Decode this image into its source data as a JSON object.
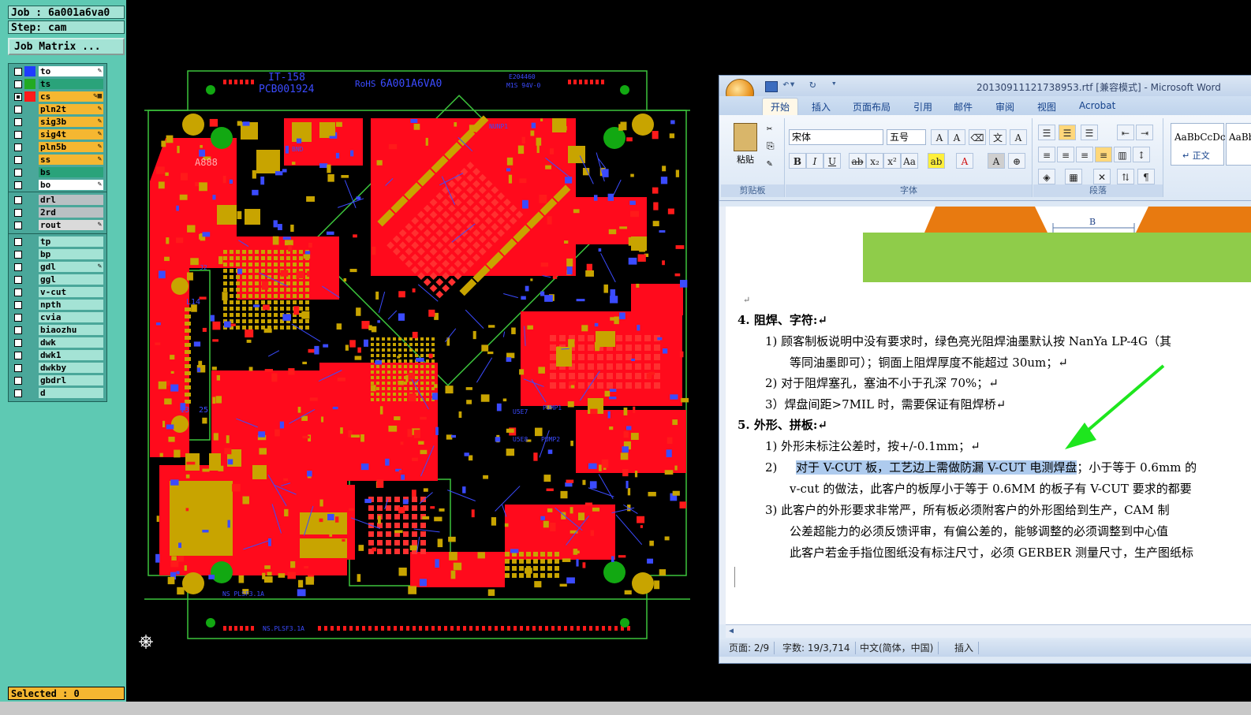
{
  "left_panel": {
    "job_label": "Job : 6a001a6va0",
    "step_label": "Step: cam",
    "job_matrix_button": "Job Matrix ...",
    "layer_groups": [
      [
        {
          "name": "to",
          "swatch": "#1f3cff",
          "bg": "#ffffff",
          "mark": "✎"
        },
        {
          "name": "ts",
          "swatch": "#22aa22",
          "bg": "#2aa37a",
          "mark": ""
        },
        {
          "name": "cs",
          "swatch": "#ff1a1a",
          "bg": "#f5b731",
          "mark": "✎▦"
        },
        {
          "name": "pln2t",
          "swatch": "",
          "bg": "#f5b731",
          "mark": "✎"
        },
        {
          "name": "sig3b",
          "swatch": "",
          "bg": "#f5b731",
          "mark": "✎"
        },
        {
          "name": "sig4t",
          "swatch": "",
          "bg": "#f5b731",
          "mark": "✎"
        },
        {
          "name": "pln5b",
          "swatch": "",
          "bg": "#f5b731",
          "mark": "✎"
        },
        {
          "name": "ss",
          "swatch": "",
          "bg": "#f5b731",
          "mark": "✎"
        },
        {
          "name": "bs",
          "swatch": "",
          "bg": "#2aa37a",
          "mark": ""
        },
        {
          "name": "bo",
          "swatch": "",
          "bg": "#ffffff",
          "mark": "✎"
        }
      ],
      [
        {
          "name": "drl",
          "swatch": "",
          "bg": "#b9c0c3",
          "mark": ""
        },
        {
          "name": "2rd",
          "swatch": "",
          "bg": "#b9c0c3",
          "mark": ""
        },
        {
          "name": "rout",
          "swatch": "",
          "bg": "#dadada",
          "mark": "✎"
        }
      ],
      [
        {
          "name": "tp",
          "swatch": "",
          "bg": "#a4e3d5",
          "mark": ""
        },
        {
          "name": "bp",
          "swatch": "",
          "bg": "#a4e3d5",
          "mark": ""
        },
        {
          "name": "gdl",
          "swatch": "",
          "bg": "#a4e3d5",
          "mark": "✎"
        },
        {
          "name": "ggl",
          "swatch": "",
          "bg": "#a4e3d5",
          "mark": ""
        },
        {
          "name": "v-cut",
          "swatch": "",
          "bg": "#a4e3d5",
          "mark": ""
        },
        {
          "name": "npth",
          "swatch": "",
          "bg": "#a4e3d5",
          "mark": ""
        },
        {
          "name": "cvia",
          "swatch": "",
          "bg": "#a4e3d5",
          "mark": ""
        },
        {
          "name": "biaozhu",
          "swatch": "",
          "bg": "#a4e3d5",
          "mark": ""
        },
        {
          "name": "dwk",
          "swatch": "",
          "bg": "#a4e3d5",
          "mark": ""
        },
        {
          "name": "dwk1",
          "swatch": "",
          "bg": "#a4e3d5",
          "mark": ""
        },
        {
          "name": "dwkby",
          "swatch": "",
          "bg": "#a4e3d5",
          "mark": ""
        },
        {
          "name": "gbdrl",
          "swatch": "",
          "bg": "#a4e3d5",
          "mark": ""
        },
        {
          "name": "d",
          "swatch": "",
          "bg": "#a4e3d5",
          "mark": ""
        }
      ]
    ],
    "selected_label": "Selected : 0"
  },
  "pcb": {
    "silk_texts": [
      "IT-158",
      "PCB001924",
      "RoHS",
      "6A001A6VA0",
      "E204460",
      "M1S 94V-0",
      "A888",
      "L14",
      "13",
      "25",
      "NS PLSF3.1A",
      "NS.PLSF3.1A",
      "BND",
      "NUNP1",
      "PUMP1",
      "PUMP2",
      "J2",
      "U5E7",
      "U5E8"
    ]
  },
  "word": {
    "title": "20130911121738953.rtf [兼容模式] - Microsoft Word",
    "tabs": [
      "开始",
      "插入",
      "页面布局",
      "引用",
      "邮件",
      "审阅",
      "视图",
      "Acrobat"
    ],
    "clipboard": {
      "paste": "粘贴",
      "group": "剪贴板"
    },
    "font": {
      "name": "宋体",
      "size": "五号",
      "group": "字体"
    },
    "paragraph_group": "段落",
    "styles": {
      "sample": "AaBbCcDc",
      "sample2": "AaBbC",
      "normal": "↵ 正文"
    },
    "figure_label": "B",
    "lines": [
      "4.   阻焊、字符:↵",
      "1)   顾客制板说明中没有要求时，绿色亮光阻焊油墨默认按 NanYa  LP-4G（其",
      "等同油墨即可）；铜面上阻焊厚度不能超过 30um；↵",
      "2)   对于阻焊塞孔，塞油不小于孔深 70%；↵",
      "3）焊盘间距>7MIL 时，需要保证有阻焊桥↵",
      "5.   外形、拼板:↵",
      "1)   外形未标注公差时，按+/-0.1mm；↵",
      "v-cut 的做法，此客户的板厚小于等于 0.6MM 的板子有 V-CUT 要求的都要",
      "3)   此客户的外形要求非常严，所有板必须附客户的外形图给到生产，CAM 制",
      "公差超能力的必须反馈评审，有偏公差的，能够调整的必须调整到中心值",
      "此客户若金手指位图纸没有标注尺寸，必须 GERBER 测量尺寸，生产图纸标"
    ],
    "line8_num": "2)",
    "line8_highlight": "对于 V-CUT 板，工艺边上需做防漏 V-CUT 电测焊盘",
    "line8_rest": "；小于等于 0.6mm 的",
    "status": [
      "页面: 2/9",
      "字数: 19/3,714",
      "中文(简体，中国)",
      "插入"
    ]
  }
}
